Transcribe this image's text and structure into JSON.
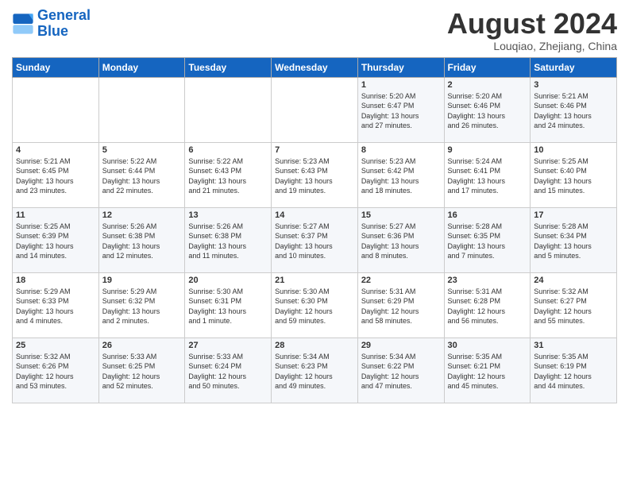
{
  "logo": {
    "line1": "General",
    "line2": "Blue"
  },
  "title": "August 2024",
  "subtitle": "Louqiao, Zhejiang, China",
  "days_of_week": [
    "Sunday",
    "Monday",
    "Tuesday",
    "Wednesday",
    "Thursday",
    "Friday",
    "Saturday"
  ],
  "weeks": [
    [
      {
        "day": "",
        "info": ""
      },
      {
        "day": "",
        "info": ""
      },
      {
        "day": "",
        "info": ""
      },
      {
        "day": "",
        "info": ""
      },
      {
        "day": "1",
        "info": "Sunrise: 5:20 AM\nSunset: 6:47 PM\nDaylight: 13 hours\nand 27 minutes."
      },
      {
        "day": "2",
        "info": "Sunrise: 5:20 AM\nSunset: 6:46 PM\nDaylight: 13 hours\nand 26 minutes."
      },
      {
        "day": "3",
        "info": "Sunrise: 5:21 AM\nSunset: 6:46 PM\nDaylight: 13 hours\nand 24 minutes."
      }
    ],
    [
      {
        "day": "4",
        "info": "Sunrise: 5:21 AM\nSunset: 6:45 PM\nDaylight: 13 hours\nand 23 minutes."
      },
      {
        "day": "5",
        "info": "Sunrise: 5:22 AM\nSunset: 6:44 PM\nDaylight: 13 hours\nand 22 minutes."
      },
      {
        "day": "6",
        "info": "Sunrise: 5:22 AM\nSunset: 6:43 PM\nDaylight: 13 hours\nand 21 minutes."
      },
      {
        "day": "7",
        "info": "Sunrise: 5:23 AM\nSunset: 6:43 PM\nDaylight: 13 hours\nand 19 minutes."
      },
      {
        "day": "8",
        "info": "Sunrise: 5:23 AM\nSunset: 6:42 PM\nDaylight: 13 hours\nand 18 minutes."
      },
      {
        "day": "9",
        "info": "Sunrise: 5:24 AM\nSunset: 6:41 PM\nDaylight: 13 hours\nand 17 minutes."
      },
      {
        "day": "10",
        "info": "Sunrise: 5:25 AM\nSunset: 6:40 PM\nDaylight: 13 hours\nand 15 minutes."
      }
    ],
    [
      {
        "day": "11",
        "info": "Sunrise: 5:25 AM\nSunset: 6:39 PM\nDaylight: 13 hours\nand 14 minutes."
      },
      {
        "day": "12",
        "info": "Sunrise: 5:26 AM\nSunset: 6:38 PM\nDaylight: 13 hours\nand 12 minutes."
      },
      {
        "day": "13",
        "info": "Sunrise: 5:26 AM\nSunset: 6:38 PM\nDaylight: 13 hours\nand 11 minutes."
      },
      {
        "day": "14",
        "info": "Sunrise: 5:27 AM\nSunset: 6:37 PM\nDaylight: 13 hours\nand 10 minutes."
      },
      {
        "day": "15",
        "info": "Sunrise: 5:27 AM\nSunset: 6:36 PM\nDaylight: 13 hours\nand 8 minutes."
      },
      {
        "day": "16",
        "info": "Sunrise: 5:28 AM\nSunset: 6:35 PM\nDaylight: 13 hours\nand 7 minutes."
      },
      {
        "day": "17",
        "info": "Sunrise: 5:28 AM\nSunset: 6:34 PM\nDaylight: 13 hours\nand 5 minutes."
      }
    ],
    [
      {
        "day": "18",
        "info": "Sunrise: 5:29 AM\nSunset: 6:33 PM\nDaylight: 13 hours\nand 4 minutes."
      },
      {
        "day": "19",
        "info": "Sunrise: 5:29 AM\nSunset: 6:32 PM\nDaylight: 13 hours\nand 2 minutes."
      },
      {
        "day": "20",
        "info": "Sunrise: 5:30 AM\nSunset: 6:31 PM\nDaylight: 13 hours\nand 1 minute."
      },
      {
        "day": "21",
        "info": "Sunrise: 5:30 AM\nSunset: 6:30 PM\nDaylight: 12 hours\nand 59 minutes."
      },
      {
        "day": "22",
        "info": "Sunrise: 5:31 AM\nSunset: 6:29 PM\nDaylight: 12 hours\nand 58 minutes."
      },
      {
        "day": "23",
        "info": "Sunrise: 5:31 AM\nSunset: 6:28 PM\nDaylight: 12 hours\nand 56 minutes."
      },
      {
        "day": "24",
        "info": "Sunrise: 5:32 AM\nSunset: 6:27 PM\nDaylight: 12 hours\nand 55 minutes."
      }
    ],
    [
      {
        "day": "25",
        "info": "Sunrise: 5:32 AM\nSunset: 6:26 PM\nDaylight: 12 hours\nand 53 minutes."
      },
      {
        "day": "26",
        "info": "Sunrise: 5:33 AM\nSunset: 6:25 PM\nDaylight: 12 hours\nand 52 minutes."
      },
      {
        "day": "27",
        "info": "Sunrise: 5:33 AM\nSunset: 6:24 PM\nDaylight: 12 hours\nand 50 minutes."
      },
      {
        "day": "28",
        "info": "Sunrise: 5:34 AM\nSunset: 6:23 PM\nDaylight: 12 hours\nand 49 minutes."
      },
      {
        "day": "29",
        "info": "Sunrise: 5:34 AM\nSunset: 6:22 PM\nDaylight: 12 hours\nand 47 minutes."
      },
      {
        "day": "30",
        "info": "Sunrise: 5:35 AM\nSunset: 6:21 PM\nDaylight: 12 hours\nand 45 minutes."
      },
      {
        "day": "31",
        "info": "Sunrise: 5:35 AM\nSunset: 6:19 PM\nDaylight: 12 hours\nand 44 minutes."
      }
    ]
  ]
}
